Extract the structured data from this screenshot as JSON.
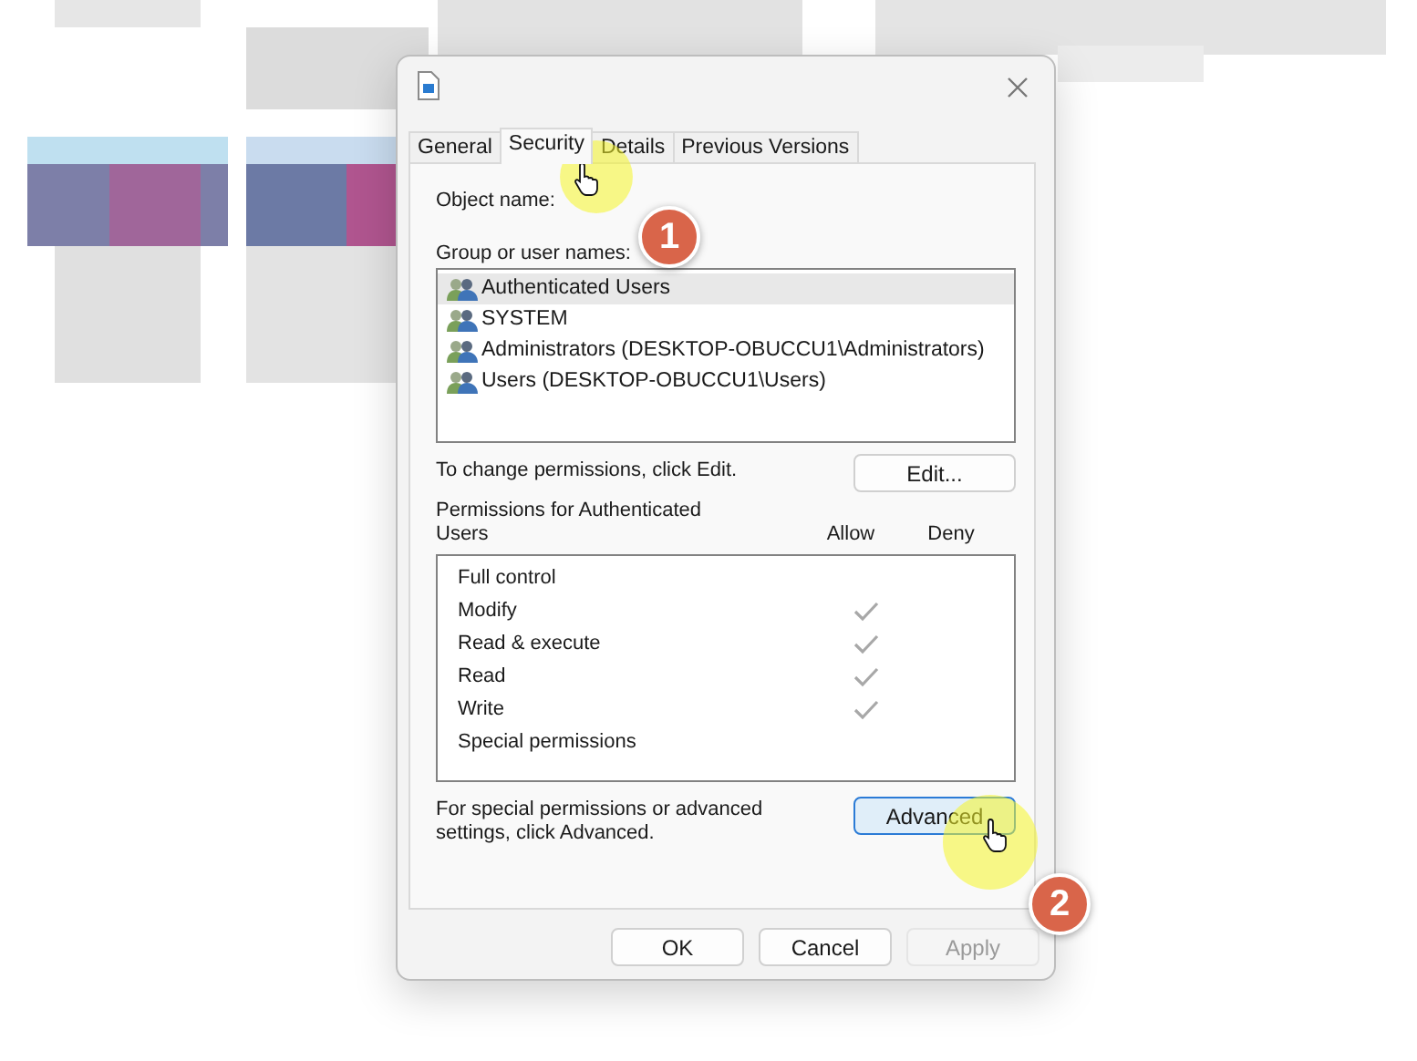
{
  "tabs": [
    {
      "label": "General",
      "selected": false
    },
    {
      "label": "Security",
      "selected": true
    },
    {
      "label": "Details",
      "selected": false
    },
    {
      "label": "Previous Versions",
      "selected": false
    }
  ],
  "object_name_label": "Object name:",
  "group_label": "Group or user names:",
  "users": [
    {
      "name": "Authenticated Users",
      "selected": true
    },
    {
      "name": "SYSTEM",
      "selected": false
    },
    {
      "name": "Administrators (DESKTOP-OBUCCU1\\Administrators)",
      "selected": false
    },
    {
      "name": "Users (DESKTOP-OBUCCU1\\Users)",
      "selected": false
    }
  ],
  "change_hint": "To change permissions, click Edit.",
  "edit_button": "Edit...",
  "permissions_label": "Permissions for Authenticated Users",
  "columns": [
    "Allow",
    "Deny"
  ],
  "permissions": [
    {
      "name": "Full control",
      "allow": false,
      "deny": false
    },
    {
      "name": "Modify",
      "allow": true,
      "deny": false
    },
    {
      "name": "Read & execute",
      "allow": true,
      "deny": false
    },
    {
      "name": "Read",
      "allow": true,
      "deny": false
    },
    {
      "name": "Write",
      "allow": true,
      "deny": false
    },
    {
      "name": "Special permissions",
      "allow": false,
      "deny": false
    }
  ],
  "advanced_hint": "For special permissions or advanced settings, click Advanced.",
  "advanced_button": "Advanced",
  "buttons": [
    {
      "label": "OK",
      "disabled": false
    },
    {
      "label": "Cancel",
      "disabled": false
    },
    {
      "label": "Apply",
      "disabled": true
    }
  ],
  "callouts": [
    {
      "number": "1"
    },
    {
      "number": "2"
    }
  ]
}
